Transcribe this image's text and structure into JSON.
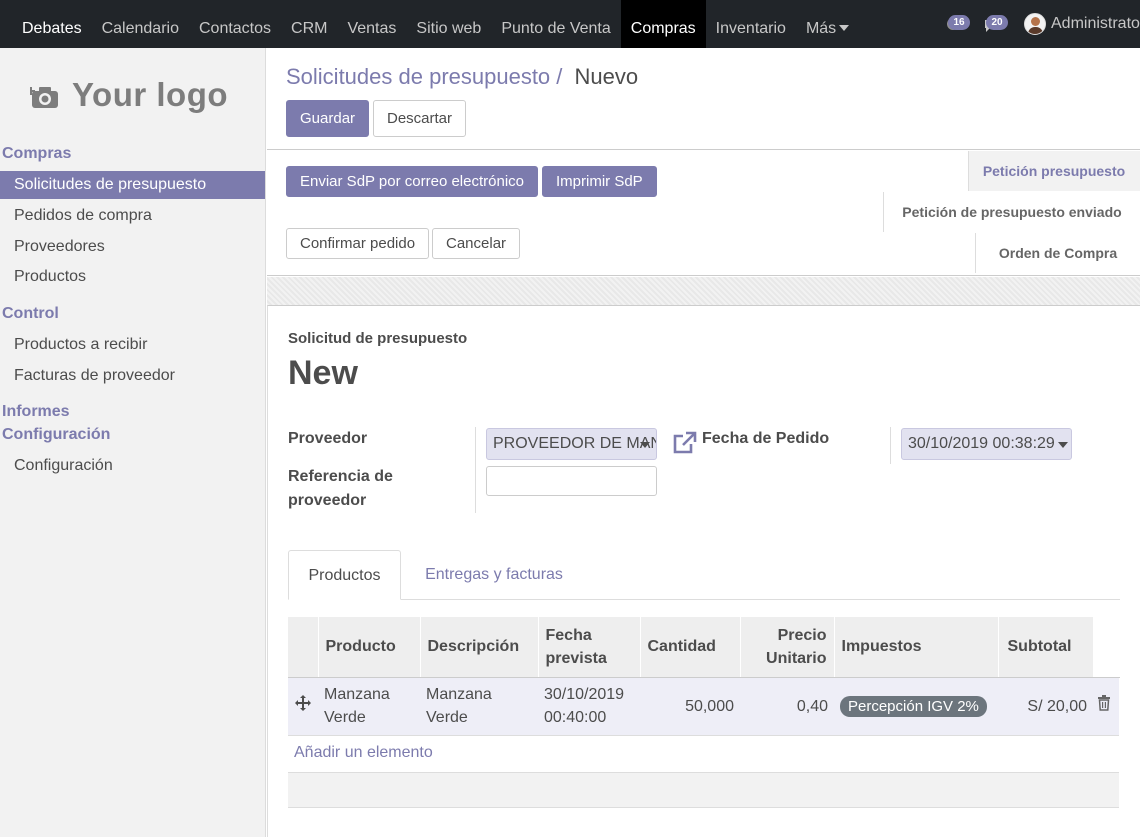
{
  "topbar": {
    "menu": [
      "Debates",
      "Calendario",
      "Contactos",
      "CRM",
      "Ventas",
      "Sitio web",
      "Punto de Venta",
      "Compras",
      "Inventario",
      "Más"
    ],
    "activity_count": "16",
    "messages_count": "20",
    "user_name": "Administrator"
  },
  "sidebar": {
    "logo_text": "Your logo",
    "sections": {
      "compras": "Compras",
      "control": "Control",
      "informes": "Informes",
      "configuracion": "Configuración"
    },
    "compras_items": [
      "Solicitudes de presupuesto",
      "Pedidos de compra",
      "Proveedores",
      "Productos"
    ],
    "control_items": [
      "Productos a recibir",
      "Facturas de proveedor"
    ],
    "config_items": [
      "Configuración"
    ]
  },
  "control_panel": {
    "breadcrumb_parent": "Solicitudes de presupuesto",
    "breadcrumb_separator": "/",
    "breadcrumb_current": "Nuevo",
    "save_label": "Guardar",
    "discard_label": "Descartar"
  },
  "header_buttons": {
    "send_email": "Enviar SdP por correo electrónico",
    "print": "Imprimir SdP",
    "confirm": "Confirmar pedido",
    "cancel": "Cancelar"
  },
  "statusbar": [
    "Petición presupuesto",
    "Petición de presupuesto enviado",
    "Orden de Compra"
  ],
  "form": {
    "doc_type": "Solicitud de presupuesto",
    "name": "New",
    "vendor_label": "Proveedor",
    "vendor_value": "PROVEEDOR DE MANZANAS",
    "vendor_ref_label_1": "Referencia de",
    "vendor_ref_label_2": "proveedor",
    "vendor_ref_value": "",
    "order_date_label": "Fecha de Pedido",
    "order_date_value": "30/10/2019 00:38:29"
  },
  "tabs": [
    "Productos",
    "Entregas y facturas"
  ],
  "table": {
    "headers": {
      "product": "Producto",
      "description": "Descripción",
      "date_1": "Fecha",
      "date_2": "prevista",
      "qty": "Cantidad",
      "price_1": "Precio",
      "price_2": "Unitario",
      "taxes": "Impuestos",
      "subtotal": "Subtotal"
    },
    "rows": [
      {
        "product_1": "Manzana",
        "product_2": "Verde",
        "description_1": "Manzana",
        "description_2": "Verde",
        "date_1": "30/10/2019",
        "date_2": "00:40:00",
        "qty": "50,000",
        "price": "0,40",
        "tax": "Percepción IGV 2%",
        "subtotal": "S/ 20,00"
      }
    ],
    "add_line": "Añadir un elemento"
  },
  "colors": {
    "brand": "#7c7bad",
    "topbar": "#212529",
    "tax_pill": "#6c757d"
  }
}
